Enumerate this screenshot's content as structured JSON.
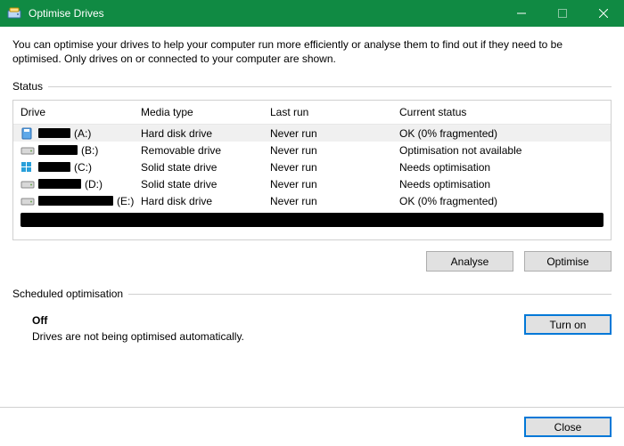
{
  "window": {
    "title": "Optimise Drives"
  },
  "intro": "You can optimise your drives to help your computer run more efficiently or analyse them to find out if they need to be optimised. Only drives on or connected to your computer are shown.",
  "status_label": "Status",
  "columns": {
    "drive": "Drive",
    "media": "Media type",
    "lastrun": "Last run",
    "status": "Current status"
  },
  "drives": [
    {
      "letter": "(A:)",
      "media": "Hard disk drive",
      "lastrun": "Never run",
      "status": "OK (0% fragmented)",
      "icon": "sd",
      "redact_w": 36
    },
    {
      "letter": "(B:)",
      "media": "Removable drive",
      "lastrun": "Never run",
      "status": "Optimisation not available",
      "icon": "hdd",
      "redact_w": 44
    },
    {
      "letter": "(C:)",
      "media": "Solid state drive",
      "lastrun": "Never run",
      "status": "Needs optimisation",
      "icon": "win",
      "redact_w": 36
    },
    {
      "letter": "(D:)",
      "media": "Solid state drive",
      "lastrun": "Never run",
      "status": "Needs optimisation",
      "icon": "hdd",
      "redact_w": 48
    },
    {
      "letter": "(E:)",
      "media": "Hard disk drive",
      "lastrun": "Never run",
      "status": "OK (0% fragmented)",
      "icon": "hdd",
      "redact_w": 84
    }
  ],
  "buttons": {
    "analyse": "Analyse",
    "optimise": "Optimise",
    "turnon": "Turn on",
    "close": "Close"
  },
  "sched": {
    "label": "Scheduled optimisation",
    "state": "Off",
    "desc": "Drives are not being optimised automatically."
  }
}
